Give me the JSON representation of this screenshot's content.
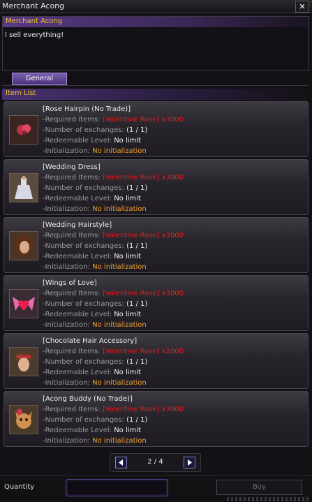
{
  "window": {
    "title": "Merchant Acong"
  },
  "npc": {
    "name": "Merchant Acong",
    "dialog": "I sell everything!"
  },
  "tabs": [
    {
      "label": "General",
      "active": true
    }
  ],
  "list_header": "Item List",
  "labels": {
    "required": "-Required Items:",
    "exchanges": "-Number of exchanges:",
    "level": "-Redeemable Level:",
    "init": "-Initialization:"
  },
  "items": [
    {
      "name": "[Rose Hairpin (No Trade)]",
      "required": "[Valentine Rose] x3000",
      "exchanges": "(1 / 1)",
      "level": "No limit",
      "init": "No initialization",
      "icon": "rose-hairpin-icon"
    },
    {
      "name": "[Wedding Dress]",
      "required": "[Valentine Rose] x3000",
      "exchanges": "(1 / 1)",
      "level": "No limit",
      "init": "No initialization",
      "icon": "wedding-dress-icon"
    },
    {
      "name": "[Wedding Hairstyle]",
      "required": "[Valentine Rose] x3000",
      "exchanges": "(1 / 1)",
      "level": "No limit",
      "init": "No initialization",
      "icon": "wedding-hairstyle-icon"
    },
    {
      "name": "[Wings of Love]",
      "required": "[Valentine Rose] x3000",
      "exchanges": "(1 / 1)",
      "level": "No limit",
      "init": "No initialization",
      "icon": "wings-of-love-icon"
    },
    {
      "name": "[Chocolate Hair Accessory]",
      "required": "[Valentine Rose] x2000",
      "exchanges": "(1 / 1)",
      "level": "No limit",
      "init": "No initialization",
      "icon": "chocolate-hair-accessory-icon"
    },
    {
      "name": "[Acong Buddy (No Trade)]",
      "required": "[Valentine Rose] x3000",
      "exchanges": "(1 / 1)",
      "level": "No limit",
      "init": "No initialization",
      "icon": "acong-buddy-icon"
    }
  ],
  "pager": {
    "text": "2 / 4"
  },
  "footer": {
    "quantity_label": "Quantity",
    "quantity_value": "",
    "buy_label": "Buy",
    "buy_enabled": false
  },
  "colors": {
    "accent_purple": "#5a3a86",
    "npc_name": "#f0c030",
    "required_red": "#e22020",
    "init_orange": "#f0a030"
  }
}
